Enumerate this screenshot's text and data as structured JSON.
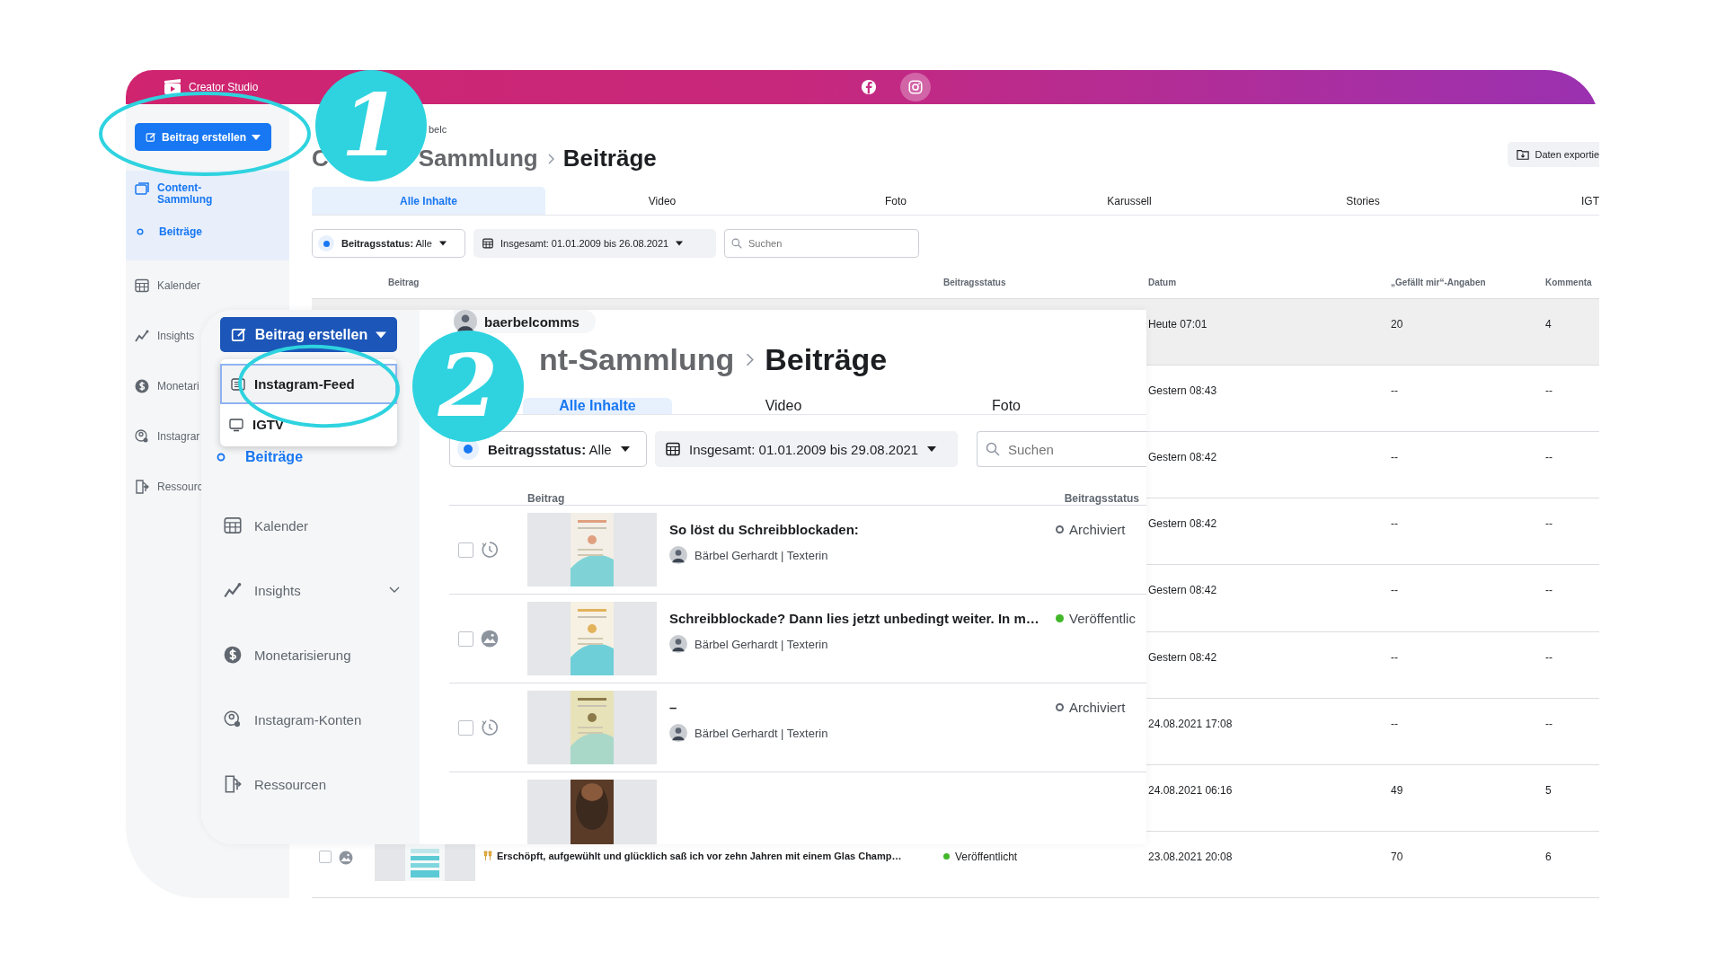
{
  "back_window": {
    "app_name": "Creator Studio",
    "platforms": [
      {
        "kind": "facebook",
        "selected": false
      },
      {
        "kind": "instagram",
        "selected": true
      }
    ],
    "create_button": "Beitrag erstellen",
    "sidebar": {
      "section": {
        "label": "Content-Sammlung",
        "selected": true
      },
      "sub_item": {
        "label": "Beiträge",
        "selected": true
      },
      "items": [
        {
          "kind": "calendar",
          "label": "Kalender"
        },
        {
          "kind": "insights",
          "label": "Insights"
        },
        {
          "kind": "money",
          "label": "Monetari"
        },
        {
          "kind": "accounts",
          "label": "Instagrar"
        },
        {
          "kind": "resources",
          "label": "Ressourc"
        }
      ]
    },
    "account_fragment": "belc",
    "breadcrumb": {
      "parent_parts": [
        "C",
        "Sammlung"
      ],
      "current": "Beiträge"
    },
    "export_button": "Daten exportie",
    "tabs": [
      {
        "label": "Alle Inhalte",
        "selected": true
      },
      {
        "label": "Video",
        "selected": false
      },
      {
        "label": "Foto",
        "selected": false
      },
      {
        "label": "Karussell",
        "selected": false
      },
      {
        "label": "Stories",
        "selected": false
      },
      {
        "label": "IGT",
        "selected": false
      }
    ],
    "status_filter": "**Beitragsstatus:** Alle",
    "date_filter": "Insgesamt: 01.01.2009 bis 26.08.2021",
    "search": {
      "placeholder": "Suchen"
    },
    "table": {
      "columns": [
        "Beitrag",
        "Beitragsstatus",
        "Datum",
        "„Gefällt mir“-Angaben",
        "Kommenta"
      ],
      "rows": [
        {
          "date": "Heute 07:01",
          "likes": "20",
          "comments": "4",
          "highlighted": true
        },
        {
          "date": "Gestern 08:43",
          "likes": "--",
          "comments": "--",
          "highlighted": false
        },
        {
          "date": "Gestern 08:42",
          "likes": "--",
          "comments": "--",
          "highlighted": false
        },
        {
          "date": "Gestern 08:42",
          "likes": "--",
          "comments": "--",
          "highlighted": false
        },
        {
          "date": "Gestern 08:42",
          "likes": "--",
          "comments": "--",
          "highlighted": false
        },
        {
          "date": "Gestern 08:42",
          "likes": "--",
          "comments": "--",
          "highlighted": false
        },
        {
          "date": "24.08.2021 17:08",
          "likes": "--",
          "comments": "--",
          "highlighted": false
        },
        {
          "date": "24.08.2021 06:16",
          "likes": "49",
          "comments": "5",
          "highlighted": false
        },
        {
          "date": "23.08.2021 20:08",
          "likes": "70",
          "comments": "6",
          "highlighted": false,
          "post": {
            "checked": false,
            "title": "Erschöpft, aufgewühlt und glücklich saß ich vor zehn Jahren mit einem Glas Champ…",
            "status": {
              "kind": "published",
              "label": "Veröffentlicht"
            }
          }
        }
      ]
    }
  },
  "front_window": {
    "create_button": "Beitrag erstellen",
    "create_menu": [
      {
        "kind": "feed",
        "label": "Instagram-Feed",
        "selected": true
      },
      {
        "kind": "tv",
        "label": "IGTV",
        "selected": false
      }
    ],
    "sub_item": {
      "label": "Beiträge",
      "selected": true
    },
    "sidebar_items": [
      {
        "kind": "calendar",
        "label": "Kalender",
        "expandable": false
      },
      {
        "kind": "insights",
        "label": "Insights",
        "expandable": true
      },
      {
        "kind": "money",
        "label": "Monetarisierung",
        "expandable": false
      },
      {
        "kind": "accounts",
        "label": "Instagram-Konten",
        "expandable": false
      },
      {
        "kind": "resources",
        "label": "Ressourcen",
        "expandable": false
      }
    ],
    "account": "baerbelcomms",
    "breadcrumb": {
      "parent": "nt-Sammlung",
      "current": "Beiträge"
    },
    "tabs": [
      {
        "label": "Alle Inhalte",
        "selected": true
      },
      {
        "label": "Video",
        "selected": false
      },
      {
        "label": "Foto",
        "selected": false
      }
    ],
    "status_filter": "**Beitragsstatus:** Alle",
    "date_filter": "Insgesamt: 01.01.2009 bis 29.08.2021",
    "search": {
      "placeholder": "Suchen"
    },
    "table": {
      "columns": [
        "Beitrag",
        "Beitragsstatus"
      ],
      "rows": [
        {
          "kind": "post",
          "checked": false,
          "title": "So löst du Schreibblockaden:",
          "author": "Bärbel Gerhardt | Texterin",
          "status": {
            "kind": "archived",
            "label": "Archiviert"
          }
        },
        {
          "kind": "post",
          "checked": false,
          "title": "Schreibblockade? Dann lies jetzt unbedingt weiter. In m…",
          "author": "Bärbel Gerhardt | Texterin",
          "status": {
            "kind": "published",
            "label": "Veröffentlic"
          }
        },
        {
          "kind": "post",
          "checked": false,
          "title": "–",
          "author": "Bärbel Gerhardt | Texterin",
          "status": {
            "kind": "archived",
            "label": "Archiviert"
          }
        },
        {
          "kind": "partial"
        }
      ]
    }
  },
  "annotations": [
    {
      "label": "1"
    },
    {
      "label": "2"
    }
  ]
}
